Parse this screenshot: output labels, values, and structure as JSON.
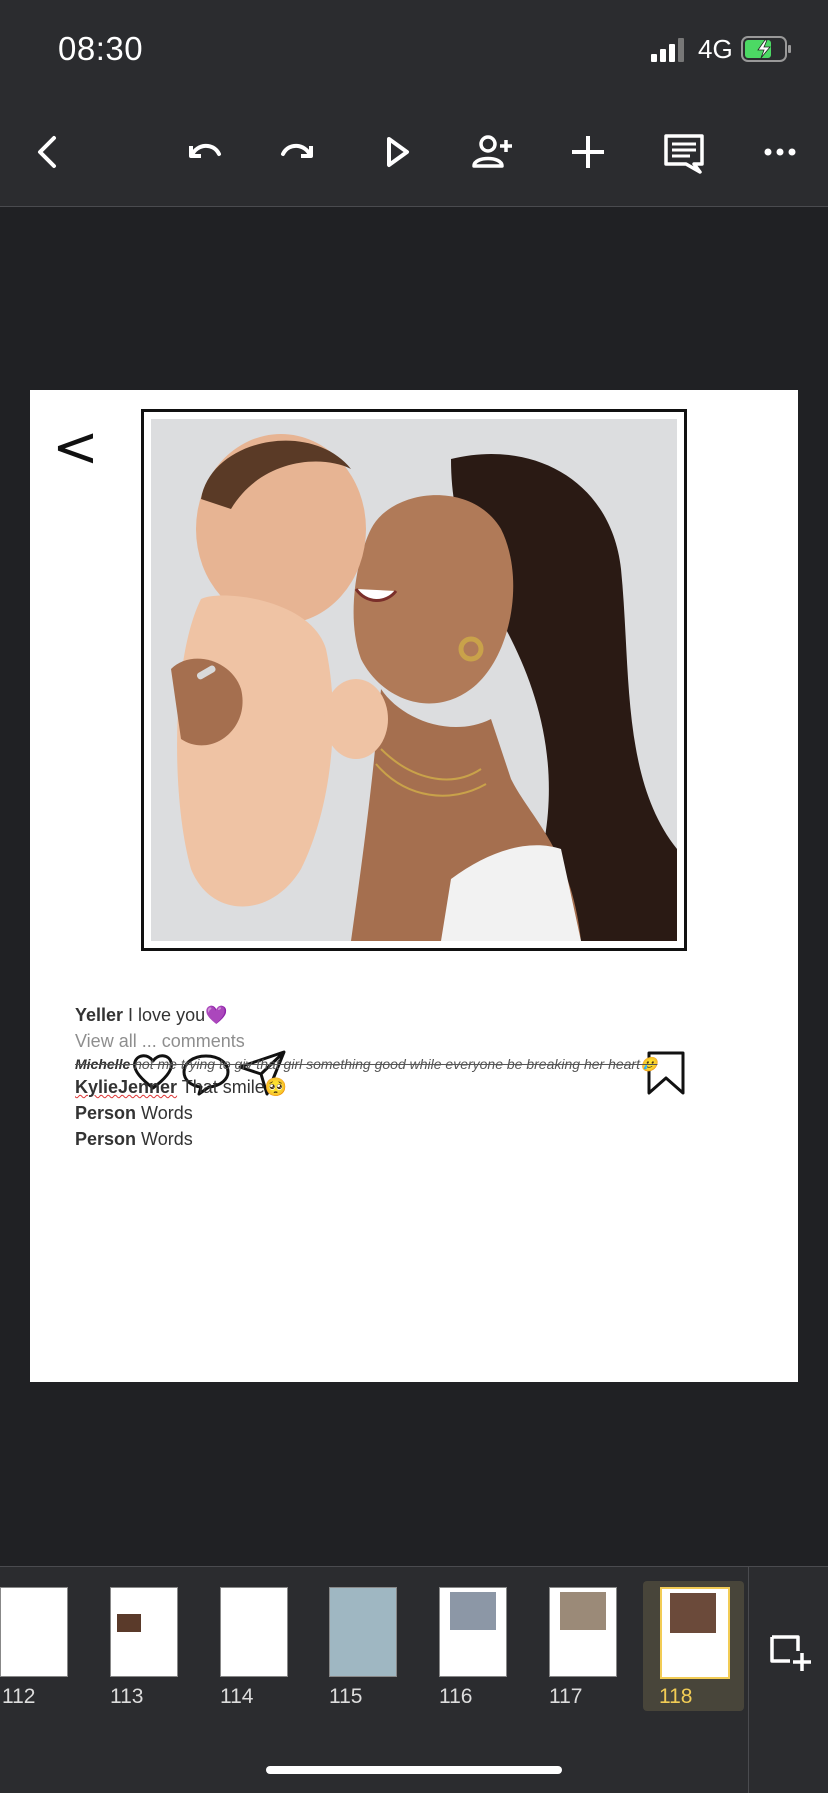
{
  "status": {
    "time": "08:30",
    "network": "4G"
  },
  "toolbar": {
    "icons": [
      "back-icon",
      "undo-icon",
      "redo-icon",
      "play-icon",
      "add-person-icon",
      "add-icon",
      "comment-icon",
      "more-icon"
    ]
  },
  "slide": {
    "back_glyph": "<",
    "comments": [
      {
        "user": "Yeller",
        "text": " I love you💜"
      },
      {
        "muted": "View all ... comments"
      },
      {
        "user": "Michelle",
        "text": " not me trying to giv that girl something good while everyone be breaking her heart🥲"
      },
      {
        "user": "KylieJenner",
        "text": " That smile🥺"
      },
      {
        "user": "Person",
        "text": " Words"
      },
      {
        "user": "Person",
        "text": " Words"
      }
    ]
  },
  "filmstrip": {
    "slides": [
      "112",
      "113",
      "114",
      "115",
      "116",
      "117",
      "118"
    ],
    "selected": "118"
  },
  "colors": {
    "accent": "#f2cc55",
    "toolbar_bg": "#2b2c2f",
    "canvas_bg": "#202124",
    "battery_green": "#4cd964"
  }
}
